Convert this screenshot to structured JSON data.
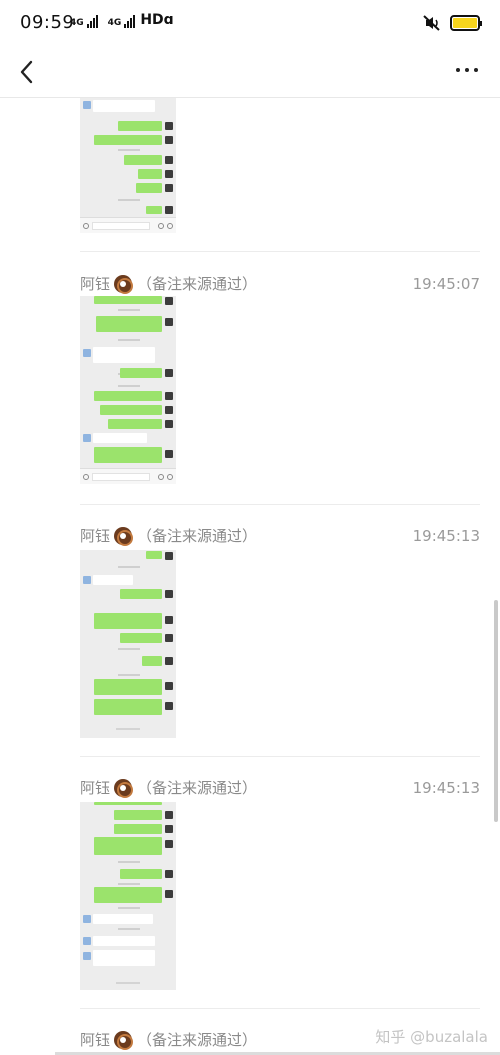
{
  "status_bar": {
    "time": "09:59",
    "network_1": "4G",
    "network_2": "4G",
    "hd": "HDɑ",
    "battery_color": "#f7d51d"
  },
  "nav": {
    "back_icon": "chevron-left-icon",
    "more_icon": "more-dots-icon"
  },
  "messages": [
    {
      "sender": "阿钰",
      "note": "（备注来源通过）",
      "time": "19:45:07"
    },
    {
      "sender": "阿钰",
      "note": "（备注来源通过）",
      "time": "19:45:13"
    },
    {
      "sender": "阿钰",
      "note": "（备注来源通过）",
      "time": "19:45:13"
    },
    {
      "sender": "阿钰",
      "note": "（备注来源通过）",
      "time": ""
    }
  ],
  "watermark": "知乎 @buzalala"
}
